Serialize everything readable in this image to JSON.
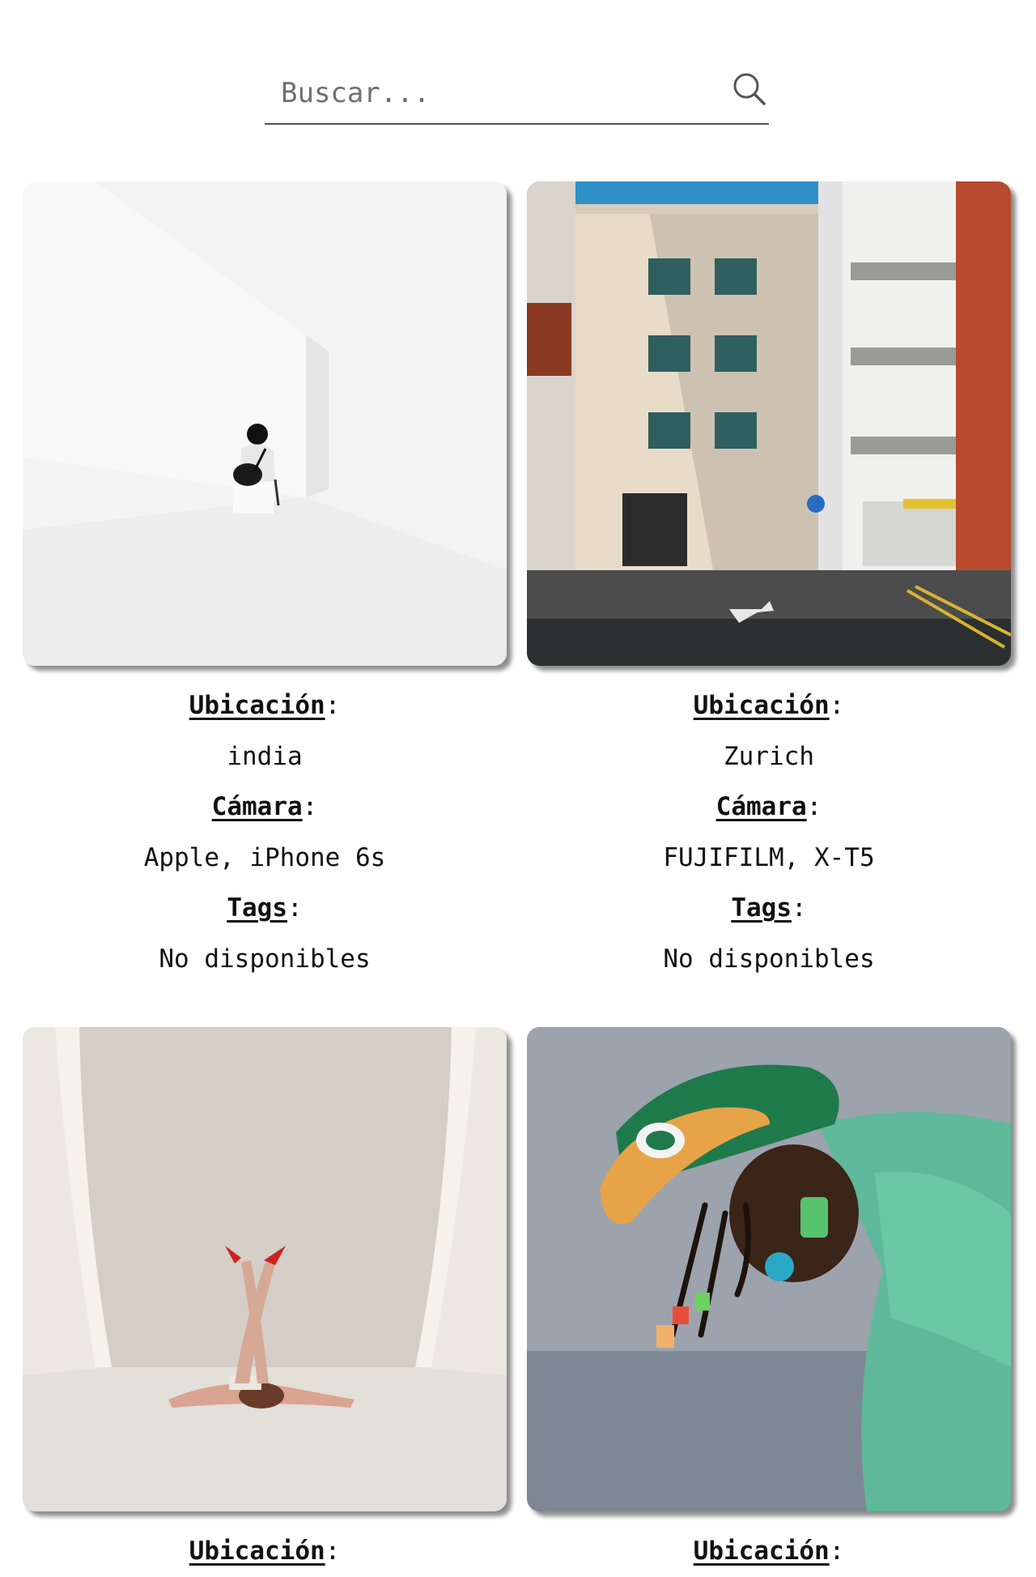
{
  "search": {
    "placeholder": "Buscar...",
    "icon": "search-icon"
  },
  "cards": [
    {
      "image": "minimalist-white-room-person-photo",
      "location_label": "Ubicación",
      "location": "india",
      "camera_label": "Cámara",
      "camera": "Apple, iPhone 6s",
      "tags_label": "Tags",
      "tags": "No disponibles"
    },
    {
      "image": "city-building-street-photo",
      "location_label": "Ubicación",
      "location": "Zurich",
      "camera_label": "Cámara",
      "camera": "FUJIFILM, X-T5",
      "tags_label": "Tags",
      "tags": "No disponibles"
    },
    {
      "image": "woman-legs-up-curtains-photo",
      "location_label": "Ubicación"
    },
    {
      "image": "person-green-cap-braids-photo",
      "location_label": "Ubicación"
    }
  ]
}
